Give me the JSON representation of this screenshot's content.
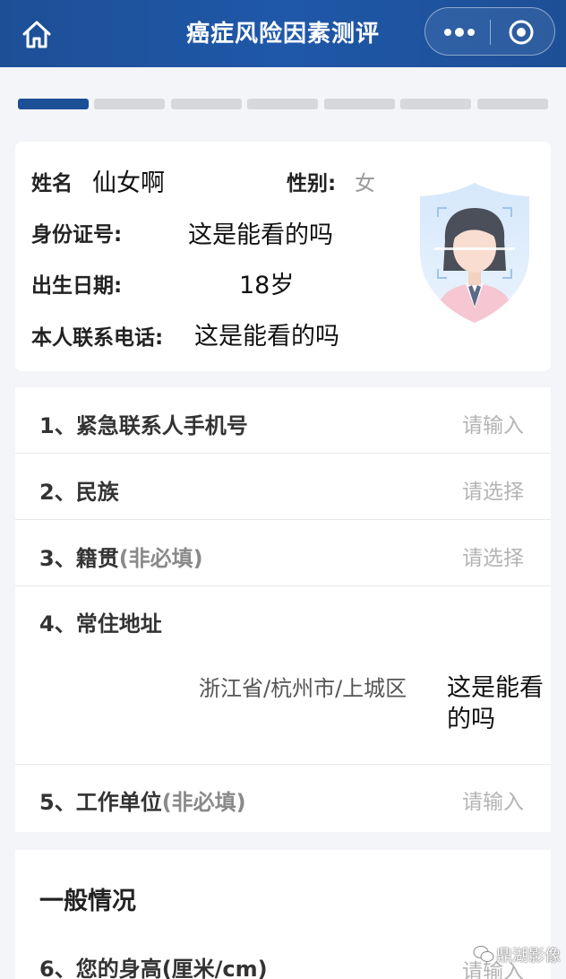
{
  "header": {
    "title": "癌症风险因素测评",
    "home_icon": "home-icon",
    "more_icon": "more-dots-icon",
    "close_icon": "target-circle-icon",
    "color": "#1d4f96"
  },
  "progress": {
    "total_steps": 7,
    "current_step": 1,
    "active_color": "#1d4f96"
  },
  "profile": {
    "name_label": "姓名",
    "name_value": "仙女啊",
    "gender_label": "性别:",
    "gender_value": "女",
    "id_label": "身份证号:",
    "id_value": "这是能看的吗",
    "birth_label": "出生日期:",
    "birth_value": "18岁",
    "phone_label": "本人联系电话:",
    "phone_value": "这是能看的吗",
    "avatar_icon": "female-avatar-shield-icon"
  },
  "form": {
    "rows": [
      {
        "label": "1、紧急联系人手机号",
        "optional": "",
        "placeholder": "请输入"
      },
      {
        "label": "2、民族",
        "optional": "",
        "placeholder": "请选择"
      },
      {
        "label": "3、籍贯",
        "optional": "(非必填)",
        "placeholder": "请选择"
      },
      {
        "label": "4、常住地址",
        "optional": "",
        "value": "浙江省/杭州市/上城区",
        "extra": "这是能看的吗"
      },
      {
        "label": "5、工作单位",
        "optional": "(非必填)",
        "placeholder": "请输入"
      }
    ]
  },
  "general": {
    "title": "一般情况",
    "q6_label": "6、您的身高(厘米/cm)",
    "q6_placeholder": "请输入"
  },
  "watermark": {
    "text": "鼎湖影像",
    "icon": "wechat-logo-icon"
  }
}
